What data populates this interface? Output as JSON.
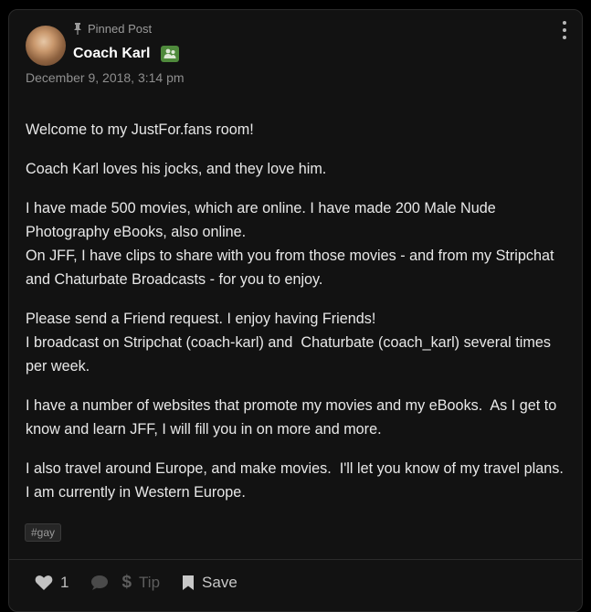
{
  "post": {
    "pinned_label": "Pinned Post",
    "author": "Coach Karl",
    "date": "December 9, 2018, 3:14 pm",
    "paragraphs": [
      "Welcome to my JustFor.fans room!",
      "Coach Karl loves his jocks, and they love him.",
      "I have made 500 movies, which are online. I have made 200 Male Nude Photography eBooks, also online.\nOn JFF, I have clips to share with you from those movies - and from my Stripchat and Chaturbate Broadcasts - for you to enjoy.",
      "Please send a Friend request. I enjoy having Friends!\nI broadcast on Stripchat (coach-karl) and  Chaturbate (coach_karl) several times per week.",
      "I have a number of websites that promote my movies and my eBooks.  As I get to know and learn JFF, I will fill you in on more and more.",
      "I also travel around Europe, and make movies.  I'll let you know of my travel plans. I am currently in Western Europe."
    ],
    "tag": "#gay"
  },
  "actions": {
    "like_count": "1",
    "tip_label": "Tip",
    "save_label": "Save"
  },
  "icons": {
    "more": "more-vertical-icon",
    "pin": "pin-icon",
    "friend": "friend-badge-icon",
    "like": "heart-icon",
    "comment": "comment-icon",
    "tip": "dollar-icon",
    "save": "bookmark-icon"
  },
  "colors": {
    "background": "#121212",
    "text": "#e8e8e8",
    "muted": "#8f8f8f",
    "friend_badge": "#4f8a3c"
  }
}
